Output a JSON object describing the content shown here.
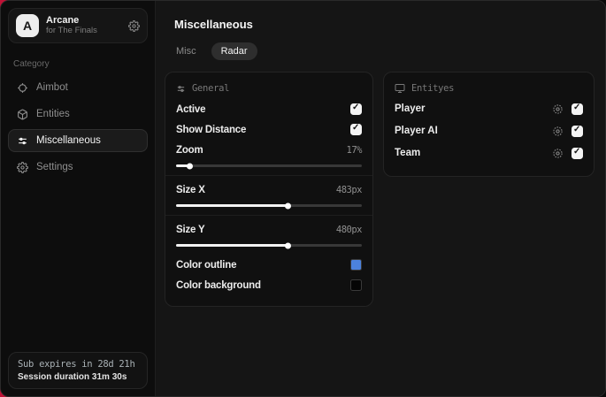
{
  "accent": {
    "backdrop_red": "#c01236"
  },
  "sidebar": {
    "profile": {
      "initial": "A",
      "name": "Arcane",
      "subtitle": "for The Finals"
    },
    "category_label": "Category",
    "items": [
      {
        "label": "Aimbot",
        "icon": "crosshair-icon",
        "active": false
      },
      {
        "label": "Entities",
        "icon": "cube-icon",
        "active": false
      },
      {
        "label": "Miscellaneous",
        "icon": "sliders-icon",
        "active": true
      },
      {
        "label": "Settings",
        "icon": "gear-icon",
        "active": false
      }
    ],
    "footer": {
      "line1": "Sub expires in 28d 21h",
      "line2": "Session duration 31m 30s"
    }
  },
  "main": {
    "title": "Miscellaneous",
    "tabs": [
      {
        "label": "Misc",
        "active": false
      },
      {
        "label": "Radar",
        "active": true
      }
    ]
  },
  "panels": {
    "general": {
      "header": "General",
      "toggles": [
        {
          "label": "Active",
          "checked": true
        },
        {
          "label": "Show Distance",
          "checked": true
        }
      ],
      "sliders": [
        {
          "label": "Zoom",
          "value": "17%",
          "percent": 7
        },
        {
          "label": "Size X",
          "value": "483px",
          "percent": 60
        },
        {
          "label": "Size Y",
          "value": "480px",
          "percent": 60
        }
      ],
      "colors": [
        {
          "label": "Color outline",
          "color": "#4c82dd"
        },
        {
          "label": "Color background",
          "color": "#050505"
        }
      ]
    },
    "entities": {
      "header": "Entityes",
      "rows": [
        {
          "label": "Player",
          "checked": true
        },
        {
          "label": "Player AI",
          "checked": true
        },
        {
          "label": "Team",
          "checked": true
        }
      ]
    }
  }
}
